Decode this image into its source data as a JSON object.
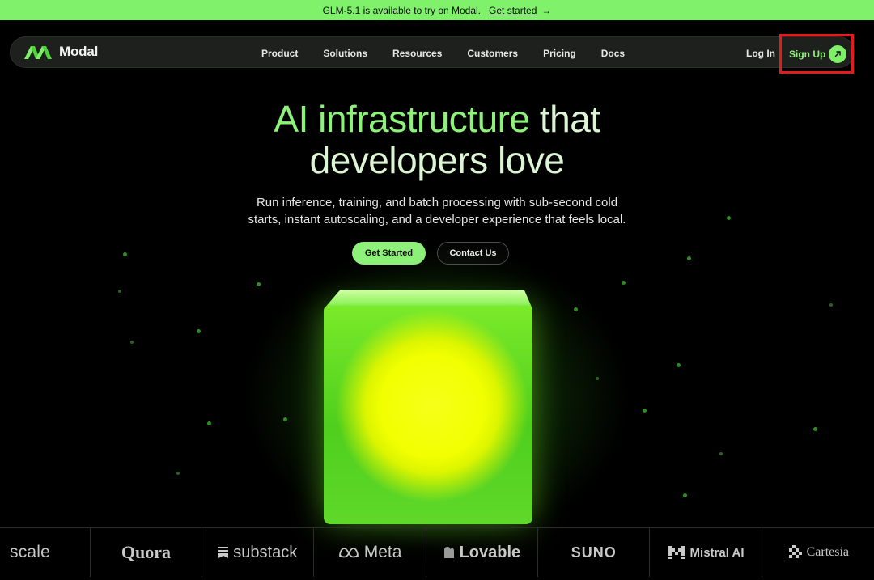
{
  "banner": {
    "text": "GLM-5.1 is available to try on Modal.",
    "link_label": "Get started",
    "arrow": "→"
  },
  "nav": {
    "brand": "Modal",
    "items": [
      {
        "label": "Product"
      },
      {
        "label": "Solutions"
      },
      {
        "label": "Resources"
      },
      {
        "label": "Customers"
      },
      {
        "label": "Pricing"
      },
      {
        "label": "Docs"
      }
    ],
    "login_label": "Log In",
    "signup_label": "Sign Up"
  },
  "hero": {
    "title_accent": "AI infrastructure",
    "title_rest": " that",
    "title_line2": "developers love",
    "subtitle_line1": "Run inference, training, and batch processing with sub-second cold",
    "subtitle_line2": "starts, instant autoscaling, and a developer experience that feels local.",
    "primary_cta": "Get Started",
    "secondary_cta": "Contact Us"
  },
  "customers": [
    {
      "name": "scale",
      "icon": null
    },
    {
      "name": "Quora",
      "icon": null
    },
    {
      "name": "substack",
      "icon": "substack-icon"
    },
    {
      "name": "Meta",
      "icon": "meta-icon"
    },
    {
      "name": "Lovable",
      "icon": "lovable-icon"
    },
    {
      "name": "SUNO",
      "icon": null
    },
    {
      "name": "Mistral AI",
      "icon": "mistral-icon"
    },
    {
      "name": "Cartesia",
      "icon": "cartesia-icon"
    }
  ],
  "colors": {
    "accent": "#8ef27a",
    "banner": "#7ff16b",
    "highlight_box": "#e21c1c",
    "background": "#000000"
  }
}
